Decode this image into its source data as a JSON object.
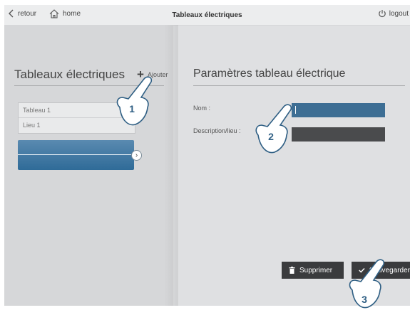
{
  "topbar": {
    "back_label": "retour",
    "home_label": "home",
    "title": "Tableaux électriques",
    "logout_label": "logout"
  },
  "left": {
    "title": "Tableaux électriques",
    "add_label": "Ajouter",
    "items": [
      {
        "name": "Tableau 1",
        "location": "Lieu 1"
      }
    ]
  },
  "right": {
    "title": "Paramètres tableau électrique",
    "name_label": "Nom :",
    "name_value": "",
    "description_label": "Description/lieu :",
    "description_value": ""
  },
  "actions": {
    "delete_label": "Supprimer",
    "save_label": "Sauvegarder"
  },
  "callouts": [
    "1",
    "2",
    "3"
  ],
  "colors": {
    "accent": "#2f6b98",
    "button_bg": "#3a3b3d",
    "panel_bg": "#dfe0e2"
  }
}
